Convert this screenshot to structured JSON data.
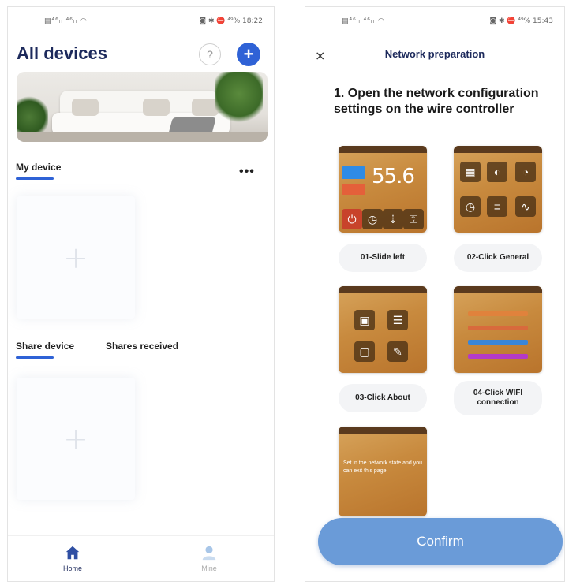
{
  "left_screen": {
    "status_bar": {
      "signal_text": "▤⁴⁶ᵢₗ ⁴⁶ᵢₗ ◠",
      "right_text": "◙ ✱ ⛔ ⁴⁹% 18:22"
    },
    "title": "All devices",
    "help_label": "?",
    "add_label": "+",
    "tabs_top": {
      "my_device": "My device"
    },
    "more_label": "•••",
    "tabs_share": {
      "share_device": "Share device",
      "shares_received": "Shares received"
    },
    "empty_plus": "+",
    "bottom_nav": {
      "home": "Home",
      "mine": "Mine"
    },
    "colors": {
      "accent": "#2f62d6",
      "title": "#1d2a5c"
    }
  },
  "right_screen": {
    "status_bar": {
      "signal_text": "▤⁴⁶ᵢₗ ⁴⁶ᵢₗ ◠",
      "right_text": "◙ ✱ ⛔ ⁴⁹% 15:43"
    },
    "close_label": "×",
    "title": "Network preparation",
    "step_heading": "1. Open the network configuration settings on the wire controller",
    "steps": [
      {
        "label": "01-Slide left",
        "temp": "55.6"
      },
      {
        "label": "02-Click General"
      },
      {
        "label": "03-Click About"
      },
      {
        "label": "04-Click WIFI connection"
      }
    ],
    "step5_note": "Set in the network state and you can exit this page",
    "confirm_label": "Confirm",
    "colors": {
      "confirm": "#6a9bd8",
      "screenshot_bg": "#c88a3e"
    }
  }
}
